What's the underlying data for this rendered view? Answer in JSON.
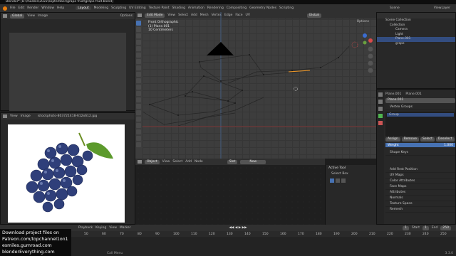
{
  "title": "Blender* [D:\\models\\2022\\september\\grape fruit\\grape fruit.blend]",
  "menu": [
    "File",
    "Edit",
    "Render",
    "Window",
    "Help"
  ],
  "workspaces": [
    "Layout",
    "Modeling",
    "Sculpting",
    "UV Editing",
    "Texture Paint",
    "Shading",
    "Animation",
    "Rendering",
    "Compositing",
    "Geometry Nodes",
    "Scripting"
  ],
  "scene_label": "Scene",
  "view_layer_label": "ViewLayer",
  "left_top_header": {
    "mode": "Global",
    "items": [
      "View",
      "Image",
      "Options"
    ]
  },
  "image_editor": {
    "items": [
      "View",
      "Image"
    ],
    "filename": "istockphoto-803721418-612x612.jpg"
  },
  "viewport": {
    "mode": "Edit Mode",
    "menu": [
      "View",
      "Select",
      "Add",
      "Mesh",
      "Vertex",
      "Edge",
      "Face",
      "UV"
    ],
    "orientation": "Global",
    "overlay_lines": [
      "Front Orthographic",
      "(1) Plane.001",
      "10 Centimeters"
    ],
    "options": "Options"
  },
  "node_header": {
    "object": "Object",
    "items": [
      "View",
      "Select",
      "Add",
      "Node"
    ],
    "slot": "Slot",
    "new_label": "New"
  },
  "active_tool": {
    "title": "Active Tool",
    "tool": "Select Box"
  },
  "outliner": {
    "title": "Scene Collection",
    "items": [
      "Collection",
      "Camera",
      "Light",
      "Plane.001",
      "grape"
    ]
  },
  "properties": {
    "object_name": "Plane.001",
    "mesh_name": "Plane.001",
    "data_name": "Plane.001",
    "vertex_groups_label": "Vertex Groups",
    "group_name": "Group",
    "assign_buttons": [
      "Assign",
      "Remove",
      "Select",
      "Deselect"
    ],
    "weight_label": "Weight",
    "weight_value": "1.000",
    "sections": [
      "Shape Keys",
      "Add Rest Position",
      "UV Maps",
      "Color Attributes",
      "Face Maps",
      "Attributes",
      "Normals",
      "Texture Space",
      "Remesh"
    ]
  },
  "timeline": {
    "items": [
      "Playback",
      "Keying",
      "View",
      "Marker"
    ],
    "ticks": [
      "50",
      "60",
      "70",
      "80",
      "90",
      "100",
      "110",
      "120",
      "130",
      "140",
      "150",
      "160",
      "170",
      "180",
      "190",
      "200",
      "210",
      "220",
      "230",
      "240",
      "250"
    ],
    "start_label": "Start",
    "start_value": "1",
    "end_label": "End",
    "end_value": "250",
    "current_frame": "1"
  },
  "status": {
    "hint": "Call Menu",
    "version": "3.3.0"
  },
  "overlay_text": [
    "Download project files on",
    "Patreon.com/topchannel1on1",
    "esmiles.gumroad.com",
    "blenderEverything.com"
  ],
  "colors": {
    "accent": "#4772b3",
    "selected_edge": "#f29926",
    "background": "#1d1d1d"
  },
  "icons": [
    "blender-logo-icon",
    "select-cursor-icon",
    "move-icon",
    "rotate-icon",
    "scale-icon",
    "transform-icon",
    "annotate-icon",
    "measure-icon",
    "camera-icon",
    "light-icon",
    "mesh-icon",
    "eye-icon",
    "wrench-icon",
    "grid-icon"
  ]
}
